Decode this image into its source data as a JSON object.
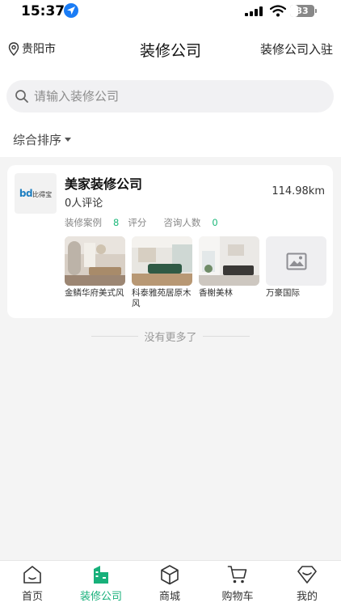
{
  "status_bar": {
    "time": "15:37",
    "battery": "33",
    "battery_fraction": 0.33
  },
  "header": {
    "city": "贵阳市",
    "title": "装修公司",
    "join_link": "装修公司入驻"
  },
  "search": {
    "placeholder": "请输入装修公司",
    "value": ""
  },
  "sort": {
    "label": "综合排序"
  },
  "company": {
    "logo_text": "bd",
    "logo_subtext": "比得宝",
    "name": "美家装修公司",
    "distance": "114.98km",
    "reviews": "0人评论",
    "stats": [
      {
        "label": "装修案例",
        "value": "8"
      },
      {
        "label": "评分",
        "value": ""
      },
      {
        "label": "咨询人数",
        "value": "0"
      }
    ],
    "cases": [
      {
        "caption": "金鳞华府美式风"
      },
      {
        "caption": "科泰雅苑居原木风"
      },
      {
        "caption": "香榭美林"
      },
      {
        "caption": "万豪国际"
      }
    ]
  },
  "end_note": "没有更多了",
  "tabbar": {
    "tabs": [
      {
        "label": "首页",
        "icon": "home-icon"
      },
      {
        "label": "装修公司",
        "icon": "building-icon",
        "active": true
      },
      {
        "label": "商城",
        "icon": "box-icon"
      },
      {
        "label": "购物车",
        "icon": "cart-icon"
      },
      {
        "label": "我的",
        "icon": "diamond-icon"
      }
    ]
  },
  "colors": {
    "accent": "#17b07a",
    "location_blue": "#1a7cf5"
  }
}
